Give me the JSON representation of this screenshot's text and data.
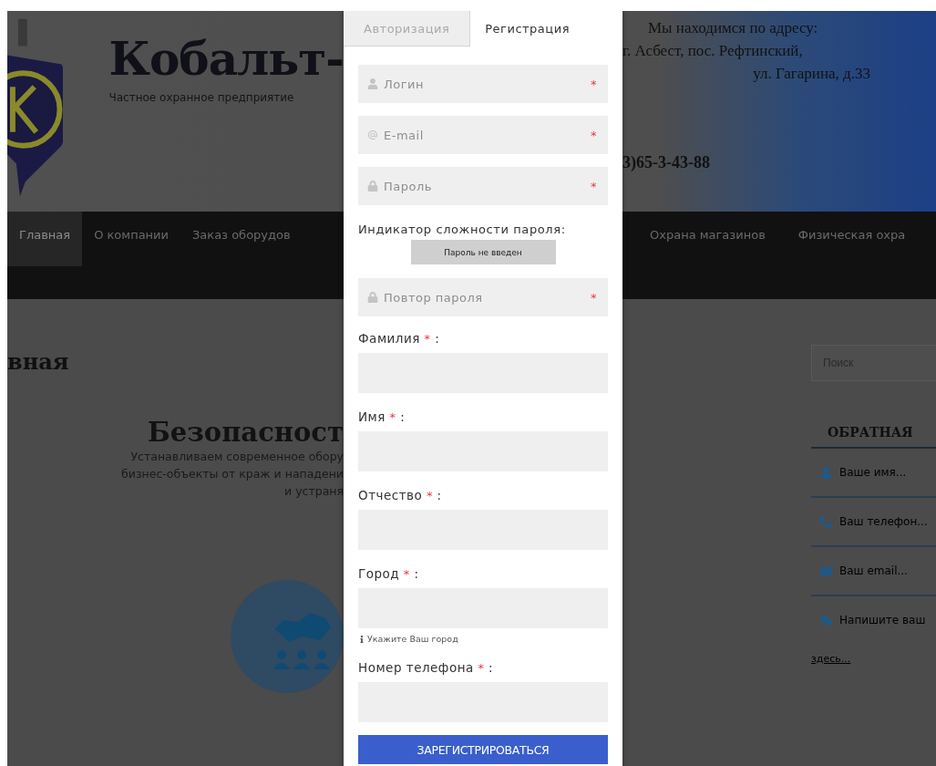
{
  "site": {
    "title": "Кобальт-",
    "subtitle": "Частное охранное предприятие",
    "address": [
      "Мы находимся по адресу:",
      "г. Асбест, пос. Рефтинский,",
      "ул. Гагарина, д.33"
    ],
    "phone": "3)65-3-43-88"
  },
  "nav_left": [
    {
      "label": "Главная",
      "selected": true
    },
    {
      "label": "О компании",
      "selected": false
    },
    {
      "label": "Заказ оборудов",
      "selected": false
    }
  ],
  "nav_right": [
    {
      "label": "Охрана магазинов",
      "selected": false
    },
    {
      "label": "Физическая охра",
      "selected": false
    }
  ],
  "content": {
    "page_heading": "вная",
    "hero_title": "Безопасност",
    "hero_lines": [
      "Устанавливаем современное обору",
      "бизнес-объекты от краж и нападени",
      "и устраня"
    ]
  },
  "sidebar": {
    "search": {
      "placeholder": "Поиск"
    },
    "feedback_title": "ОБРАТНАЯ",
    "fields": [
      {
        "kind": "person",
        "placeholder": "Ваше имя..."
      },
      {
        "kind": "phone",
        "placeholder": "Ваш телефон..."
      },
      {
        "kind": "mail",
        "placeholder": "Ваш email..."
      },
      {
        "kind": "chat",
        "placeholder": "Напишите ваш"
      }
    ],
    "message_tail": "здесь..."
  },
  "modal": {
    "tabs": [
      {
        "label": "Авторизация",
        "selected": false
      },
      {
        "label": "Регистрация",
        "selected": true
      }
    ],
    "icon_fields": [
      {
        "kind": "user",
        "placeholder": "Логин",
        "required": true
      },
      {
        "kind": "at",
        "placeholder": "E-mail",
        "required": true
      },
      {
        "kind": "lock",
        "placeholder": "Пароль",
        "required": true
      }
    ],
    "strength_label": "Индикатор сложности пароля:",
    "strength_status": "Пароль не введен",
    "repeat_field": {
      "kind": "lock",
      "placeholder": "Повтор пароля",
      "required": true
    },
    "labeled_fields": [
      {
        "label": "Фамилия",
        "required": true
      },
      {
        "label": "Имя",
        "required": true
      },
      {
        "label": "Отчество",
        "required": true
      },
      {
        "label": "Город",
        "required": true,
        "hint": "Укажите Ваш город"
      },
      {
        "label": "Номер телефона",
        "required": true
      }
    ],
    "required_mark": "*",
    "label_suffix": ":",
    "submit": "ЗАРЕГИСТРИРОВАТЬСЯ"
  }
}
